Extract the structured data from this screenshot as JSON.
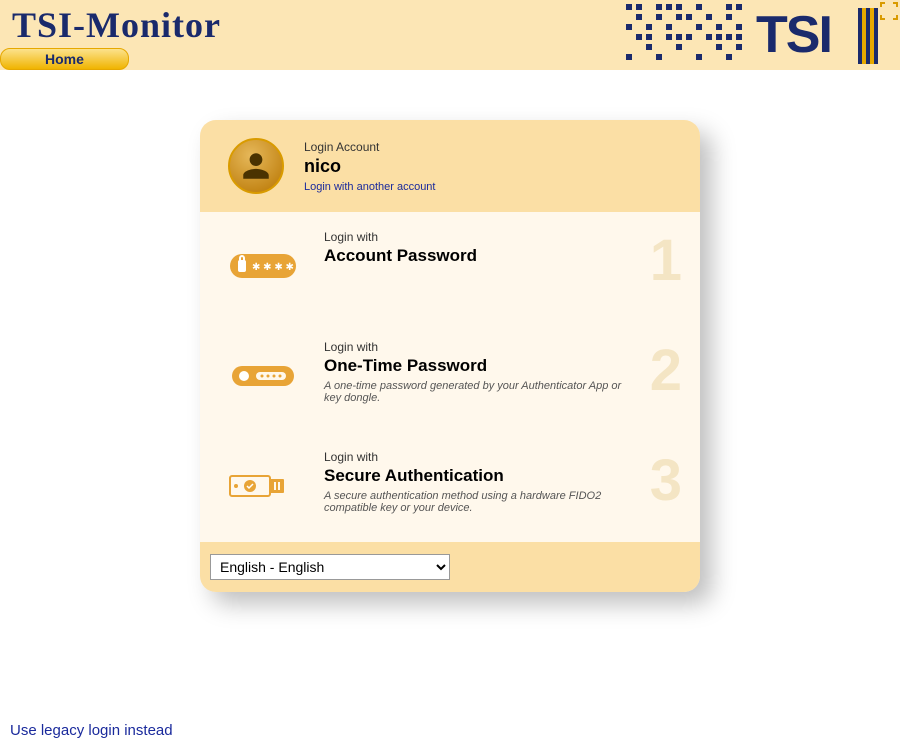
{
  "header": {
    "app_title": "TSI-Monitor",
    "nav_home": "Home"
  },
  "card": {
    "login_account_label": "Login Account",
    "username": "nico",
    "another_account_link": "Login with another account",
    "methods": [
      {
        "number": "1",
        "small": "Login with",
        "title": "Account Password",
        "desc": ""
      },
      {
        "number": "2",
        "small": "Login with",
        "title": "One-Time Password",
        "desc": "A one-time password generated by your Authenticator App or key dongle."
      },
      {
        "number": "3",
        "small": "Login with",
        "title": "Secure Authentication",
        "desc": "A secure authentication method using a hardware FIDO2 compatible key or your device."
      }
    ],
    "language": "English - English"
  },
  "legacy_link": "Use legacy login instead"
}
